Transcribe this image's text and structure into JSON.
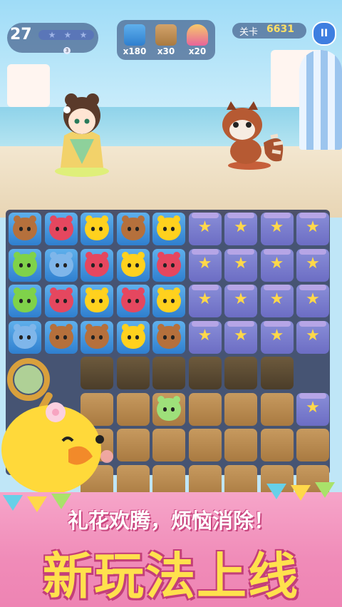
{
  "hud": {
    "moves": "27",
    "star_count": "3",
    "goals": [
      {
        "icon": "ice-block-icon",
        "count": "x180",
        "color": "#2f7fcf"
      },
      {
        "icon": "wooden-crate-icon",
        "count": "x30",
        "color": "#b5864b"
      },
      {
        "icon": "cake-icon",
        "count": "x20",
        "color": "#e8649a"
      }
    ],
    "stage_label": "关卡",
    "stage_number": "6631",
    "pause_symbol": "II"
  },
  "banner": {
    "slogan": "礼花欢腾，烦恼消除！",
    "headline": "新玩法上线"
  },
  "colors": {
    "ice": "#2f7fcf",
    "drum": "#7b7ccf",
    "crate": "#b5864b",
    "banner_pink": "#f08bb8",
    "headline_yellow": "#ffe14d"
  }
}
